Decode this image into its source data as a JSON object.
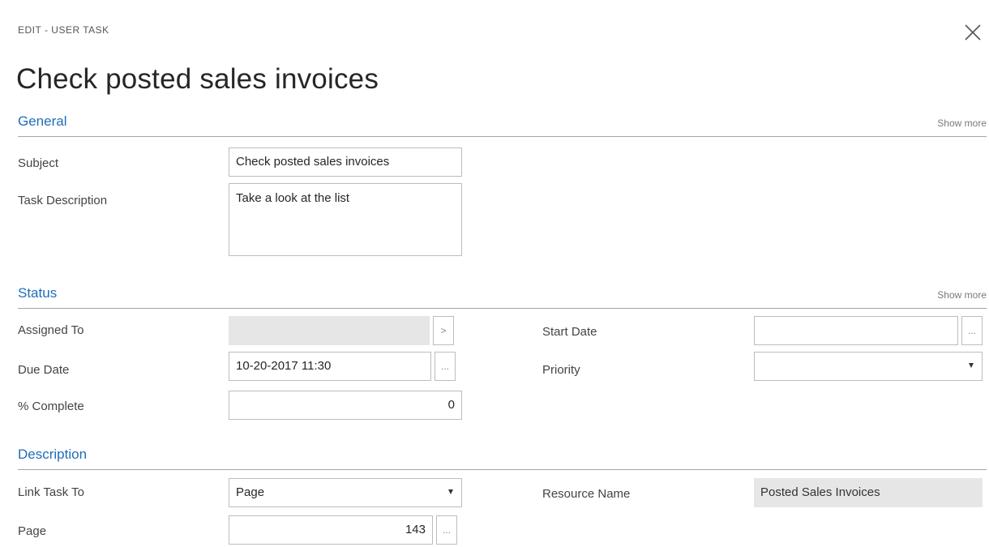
{
  "header": {
    "kicker": "EDIT - USER TASK",
    "title": "Check posted sales invoices",
    "close_icon": "close-icon"
  },
  "sections": {
    "general": {
      "title": "General",
      "show_more": "Show more",
      "subject_label": "Subject",
      "subject_value": "Check posted sales invoices",
      "task_description_label": "Task Description",
      "task_description_value": "Take a look at the list"
    },
    "status": {
      "title": "Status",
      "show_more": "Show more",
      "assigned_to_label": "Assigned To",
      "assigned_to_value": "",
      "assigned_to_button": ">",
      "start_date_label": "Start Date",
      "start_date_value": "",
      "start_date_button": "...",
      "due_date_label": "Due Date",
      "due_date_value": "10-20-2017 11:30",
      "due_date_button": "...",
      "priority_label": "Priority",
      "priority_value": "",
      "percent_complete_label": "% Complete",
      "percent_complete_value": "0"
    },
    "description": {
      "title": "Description",
      "link_task_to_label": "Link Task To",
      "link_task_to_value": "Page",
      "resource_name_label": "Resource Name",
      "resource_name_value": "Posted Sales Invoices",
      "page_label": "Page",
      "page_value": "143",
      "page_button": "..."
    }
  },
  "colors": {
    "section_title": "#1f6eb8",
    "divider": "#a6a6a6",
    "readonly_fill": "#e6e6e6"
  }
}
